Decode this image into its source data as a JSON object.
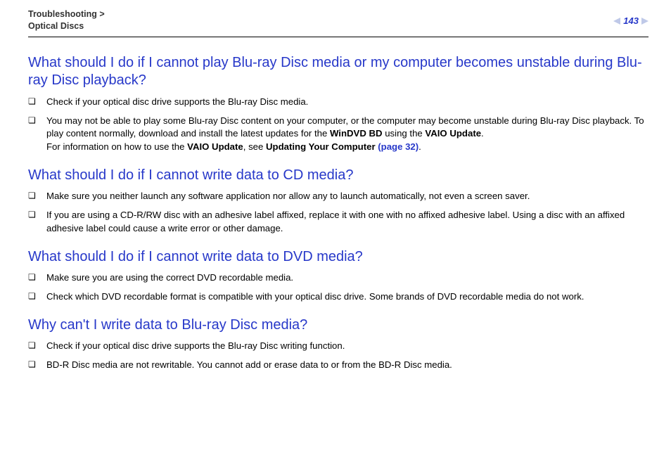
{
  "header": {
    "breadcrumb_line1": "Troubleshooting >",
    "breadcrumb_line2": "Optical Discs",
    "page_number": "143"
  },
  "sections": [
    {
      "heading": "What should I do if I cannot play Blu-ray Disc media or my computer becomes unstable during Blu-ray Disc playback?",
      "items": [
        {
          "runs": [
            {
              "t": "Check if your optical disc drive supports the Blu-ray Disc media."
            }
          ]
        },
        {
          "runs": [
            {
              "t": "You may not be able to play some Blu-ray Disc content on your computer, or the computer may become unstable during Blu-ray Disc playback. To play content normally, download and install the latest updates for the "
            },
            {
              "t": "WinDVD BD",
              "bold": true
            },
            {
              "t": " using the "
            },
            {
              "t": "VAIO Update",
              "bold": true
            },
            {
              "t": "."
            },
            {
              "br": true
            },
            {
              "t": "For information on how to use the "
            },
            {
              "t": "VAIO Update",
              "bold": true
            },
            {
              "t": ", see "
            },
            {
              "t": "Updating Your Computer ",
              "bold": true
            },
            {
              "t": "(page 32)",
              "link": true
            },
            {
              "t": "."
            }
          ]
        }
      ]
    },
    {
      "heading": "What should I do if I cannot write data to CD media?",
      "items": [
        {
          "runs": [
            {
              "t": "Make sure you neither launch any software application nor allow any to launch automatically, not even a screen saver."
            }
          ]
        },
        {
          "runs": [
            {
              "t": "If you are using a CD-R/RW disc with an adhesive label affixed, replace it with one with no affixed adhesive label. Using a disc with an affixed adhesive label could cause a write error or other damage."
            }
          ]
        }
      ]
    },
    {
      "heading": "What should I do if I cannot write data to DVD media?",
      "items": [
        {
          "runs": [
            {
              "t": "Make sure you are using the correct DVD recordable media."
            }
          ]
        },
        {
          "runs": [
            {
              "t": "Check which DVD recordable format is compatible with your optical disc drive. Some brands of DVD recordable media do not work."
            }
          ]
        }
      ]
    },
    {
      "heading": "Why can't I write data to Blu-ray Disc media?",
      "items": [
        {
          "runs": [
            {
              "t": "Check if your optical disc drive supports the Blu-ray Disc writing function."
            }
          ]
        },
        {
          "runs": [
            {
              "t": "BD-R Disc media are not rewritable. You cannot add or erase data to or from the BD-R Disc media."
            }
          ]
        }
      ]
    }
  ]
}
